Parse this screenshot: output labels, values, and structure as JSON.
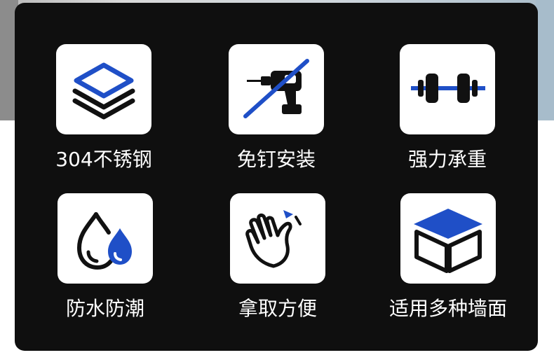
{
  "colors": {
    "panel": "#0f0f0f",
    "tile": "#ffffff",
    "accent_blue": "#1f4fc7",
    "icon_black": "#111111",
    "label": "#ffffff"
  },
  "features": [
    {
      "label": "304不锈钢",
      "icon": "layers-icon"
    },
    {
      "label": "免钉安装",
      "icon": "no-drill-icon"
    },
    {
      "label": "强力承重",
      "icon": "dumbbell-icon"
    },
    {
      "label": "防水防潮",
      "icon": "water-drops-icon"
    },
    {
      "label": "拿取方便",
      "icon": "hand-wave-icon"
    },
    {
      "label": "适用多种墙面",
      "icon": "box-icon"
    }
  ]
}
